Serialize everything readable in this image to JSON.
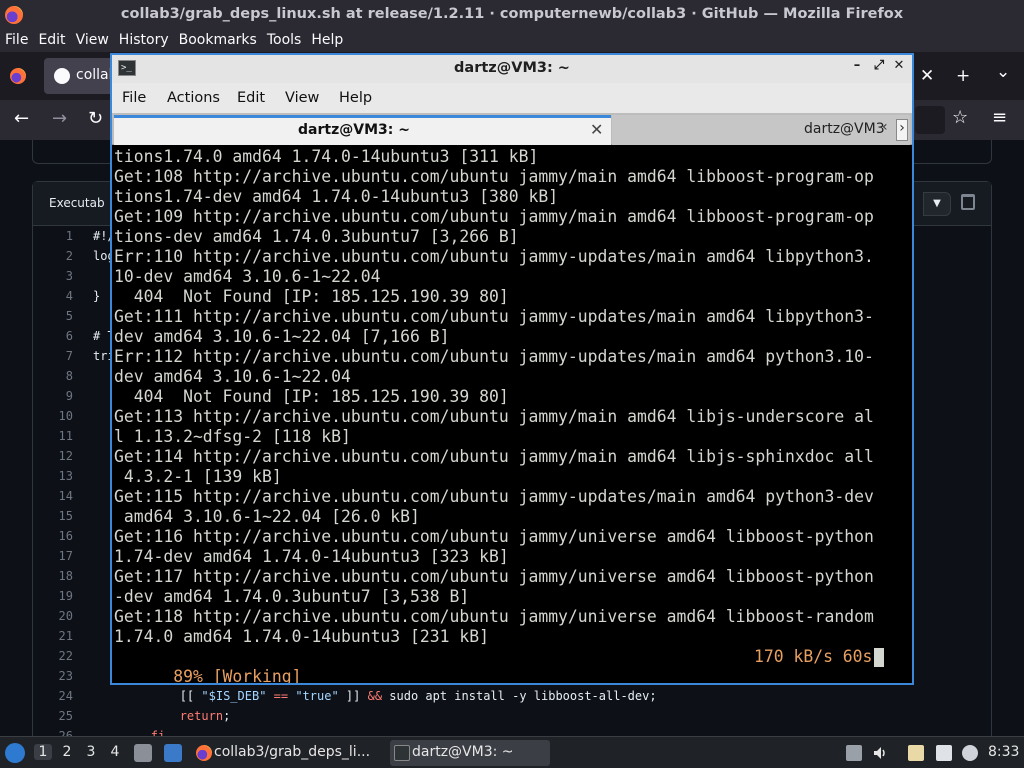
{
  "firefox": {
    "title": "collab3/grab_deps_linux.sh at release/1.2.11 · computernewb/collab3 · GitHub — Mozilla Firefox",
    "menu": [
      "File",
      "Edit",
      "View",
      "History",
      "Bookmarks",
      "Tools",
      "Help"
    ],
    "tab_label": "collab",
    "tab_controls": {
      "close": "✕",
      "new": "+",
      "list": "⌄"
    },
    "nav": {
      "back": "←",
      "forward": "→",
      "reload": "↻",
      "bookmark": "☆",
      "menu": "≡"
    }
  },
  "github": {
    "top_box_text": "...",
    "code_header_label": "Executab",
    "lines": [
      {
        "n": "1",
        "code": "#!/"
      },
      {
        "n": "2",
        "code": "log"
      },
      {
        "n": "3",
        "code": ""
      },
      {
        "n": "4",
        "code": "}"
      },
      {
        "n": "5",
        "code": ""
      },
      {
        "n": "6",
        "code": "# T"
      },
      {
        "n": "7",
        "code": "tri"
      },
      {
        "n": "8",
        "code": ""
      },
      {
        "n": "9",
        "code": ""
      },
      {
        "n": "10",
        "code": ""
      },
      {
        "n": "11",
        "code": ""
      },
      {
        "n": "12",
        "code": ""
      },
      {
        "n": "13",
        "code": ""
      },
      {
        "n": "14",
        "code": ""
      },
      {
        "n": "15",
        "code": ""
      },
      {
        "n": "16",
        "code": ""
      },
      {
        "n": "17",
        "code": ""
      },
      {
        "n": "18",
        "code": ""
      },
      {
        "n": "19",
        "code": ""
      },
      {
        "n": "20",
        "code": ""
      },
      {
        "n": "21",
        "code": ""
      },
      {
        "n": "22",
        "code": ""
      },
      {
        "n": "23",
        "code": ""
      },
      {
        "n": "24",
        "code": ""
      },
      {
        "n": "25",
        "code": ""
      },
      {
        "n": "26",
        "code": ""
      }
    ],
    "line24": {
      "indent": "            ",
      "open": "[[ ",
      "var": "\"$IS_DEB\"",
      "eq": " == ",
      "val": "\"true\"",
      "close": " ]] ",
      "and": "&&",
      "cmd": " sudo apt install -y libboost-all-dev;"
    },
    "line25": {
      "indent": "            ",
      "kw": "return",
      "rest": ";"
    },
    "line26": {
      "indent": "        ",
      "kw": "fi"
    }
  },
  "terminal": {
    "title": "dartz@VM3: ~",
    "menu": [
      "File",
      "Actions",
      "Edit",
      "View",
      "Help"
    ],
    "tabs": [
      {
        "label": "dartz@VM3: ~",
        "active": true
      },
      {
        "label": "dartz@VM3",
        "active": false
      }
    ],
    "window_buttons": {
      "minimize": "–",
      "maximize": "⤢",
      "close": "✕"
    },
    "tab_close": "✕",
    "tab_scroll_left": "‹",
    "tab_scroll_right": "›",
    "lines": [
      "tions1.74.0 amd64 1.74.0-14ubuntu3 [311 kB]",
      "Get:108 http://archive.ubuntu.com/ubuntu jammy/main amd64 libboost-program-op",
      "tions1.74-dev amd64 1.74.0-14ubuntu3 [380 kB]",
      "Get:109 http://archive.ubuntu.com/ubuntu jammy/main amd64 libboost-program-op",
      "tions-dev amd64 1.74.0.3ubuntu7 [3,266 B]",
      "Err:110 http://archive.ubuntu.com/ubuntu jammy-updates/main amd64 libpython3.",
      "10-dev amd64 3.10.6-1~22.04",
      "  404  Not Found [IP: 185.125.190.39 80]",
      "Get:111 http://archive.ubuntu.com/ubuntu jammy-updates/main amd64 libpython3-",
      "dev amd64 3.10.6-1~22.04 [7,166 B]",
      "Err:112 http://archive.ubuntu.com/ubuntu jammy-updates/main amd64 python3.10-",
      "dev amd64 3.10.6-1~22.04",
      "  404  Not Found [IP: 185.125.190.39 80]",
      "Get:113 http://archive.ubuntu.com/ubuntu jammy/main amd64 libjs-underscore al",
      "l 1.13.2~dfsg-2 [118 kB]",
      "Get:114 http://archive.ubuntu.com/ubuntu jammy/main amd64 libjs-sphinxdoc all",
      " 4.3.2-1 [139 kB]",
      "Get:115 http://archive.ubuntu.com/ubuntu jammy-updates/main amd64 python3-dev",
      " amd64 3.10.6-1~22.04 [26.0 kB]",
      "Get:116 http://archive.ubuntu.com/ubuntu jammy/universe amd64 libboost-python",
      "1.74-dev amd64 1.74.0-14ubuntu3 [323 kB]",
      "Get:117 http://archive.ubuntu.com/ubuntu jammy/universe amd64 libboost-python",
      "-dev amd64 1.74.0.3ubuntu7 [3,538 B]",
      "Get:118 http://archive.ubuntu.com/ubuntu jammy/universe amd64 libboost-random",
      "1.74.0 amd64 1.74.0-14ubuntu3 [231 kB]"
    ],
    "status_left": "89% [Working]",
    "status_right": "170 kB/s 60s"
  },
  "taskbar": {
    "workspaces": [
      "1",
      "2",
      "3",
      "4"
    ],
    "active_workspace": "1",
    "tasks": [
      {
        "label": "collab3/grab_deps_li..."
      },
      {
        "label": "dartz@VM3: ~"
      }
    ],
    "clock": "8:33"
  }
}
